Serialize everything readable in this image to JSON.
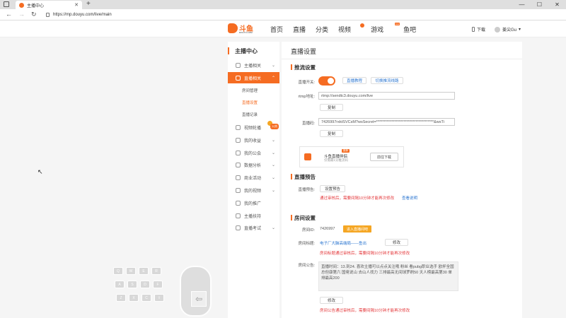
{
  "browser": {
    "tab_title": "主播中心",
    "tab_close": "✕",
    "new_tab": "+",
    "url": "https://mp.douyu.com/live/main",
    "win_min": "—",
    "win_max": "☐",
    "win_close": "✕"
  },
  "header": {
    "logo_text": "斗鱼",
    "logo_sub": "DOUYU.COM",
    "nav": [
      "首页",
      "直播",
      "分类",
      "视频",
      "游戏",
      "鱼吧"
    ],
    "new_badge": "new",
    "download": "下载",
    "username": "姜尖Gu",
    "caret": "▾"
  },
  "sidebar": {
    "title": "主播中心",
    "items": [
      {
        "label": "主播相关",
        "arrow": "⌄"
      },
      {
        "label": "直播相关",
        "arrow": "⌃"
      },
      {
        "label": "视频轮播",
        "arrow": ""
      },
      {
        "label": "我的收益",
        "arrow": "⌄"
      },
      {
        "label": "我的公会",
        "arrow": "⌄"
      },
      {
        "label": "数据分析",
        "arrow": "⌄"
      },
      {
        "label": "商业活动",
        "arrow": "⌄"
      },
      {
        "label": "我的视频",
        "arrow": "⌄"
      },
      {
        "label": "我的推广",
        "arrow": ""
      },
      {
        "label": "主播扶持",
        "arrow": ""
      },
      {
        "label": "直播考试",
        "arrow": "⌄"
      }
    ],
    "subitems": [
      "房间管理",
      "直播设置",
      "直播记录"
    ],
    "hot": "火热"
  },
  "content": {
    "title": "直播设置",
    "push": {
      "heading": "推流设置",
      "switch_label": "直播开关:",
      "tutorial": "直播教程",
      "switch_line": "切换推流线路",
      "rtmp_label": "rtmp地址:",
      "rtmp_value": "rtmp://sendtc3.douyu.com/live",
      "copy": "复制",
      "code_label": "直播码:",
      "code_value": "7426997rxktSVCsM?wsSecret=**************************************&wsTi",
      "copy2": "复制",
      "app_title": "斗鱼直播伴侣",
      "app_sub": "仅需最1分推流码",
      "app_tag": "推荐",
      "app_download": "前往下载"
    },
    "preview": {
      "heading": "直播预告",
      "label": "直播预告:",
      "button": "设置预告",
      "note": "通过审核后，需要间隔10分钟才能再次修改",
      "link": "查看说明"
    },
    "room": {
      "heading": "房间设置",
      "id_label": "房间ID:",
      "id_value": "7426997",
      "enter": "进入直播间吧",
      "title_label": "房间标题:",
      "title_value": "电子厂大脑高端局——鱼出",
      "modify": "修改",
      "title_note": "房间标题通过审核后，需要间隔10分钟才能再次修改",
      "notice_label": "房间公告:",
      "notice_text": "直播时间：13.到24. 喜欢主播可以点点关注哦 粉丝 看pubg职业选手 欧杯全国总但康第六 国佬说山 去山人找力 三排最高无间球罗刷50 天人榜最高第30 单排最高200",
      "modify2": "修改",
      "notice_note": "房间公告通过审核后，需要间隔10分钟才能再次修改"
    }
  },
  "overlay": {
    "keys": [
      "Q",
      "W",
      "E",
      "R",
      "A",
      "S",
      "D",
      "F",
      "Z",
      "X",
      "C",
      "⇧"
    ],
    "arrow": "⇦"
  }
}
